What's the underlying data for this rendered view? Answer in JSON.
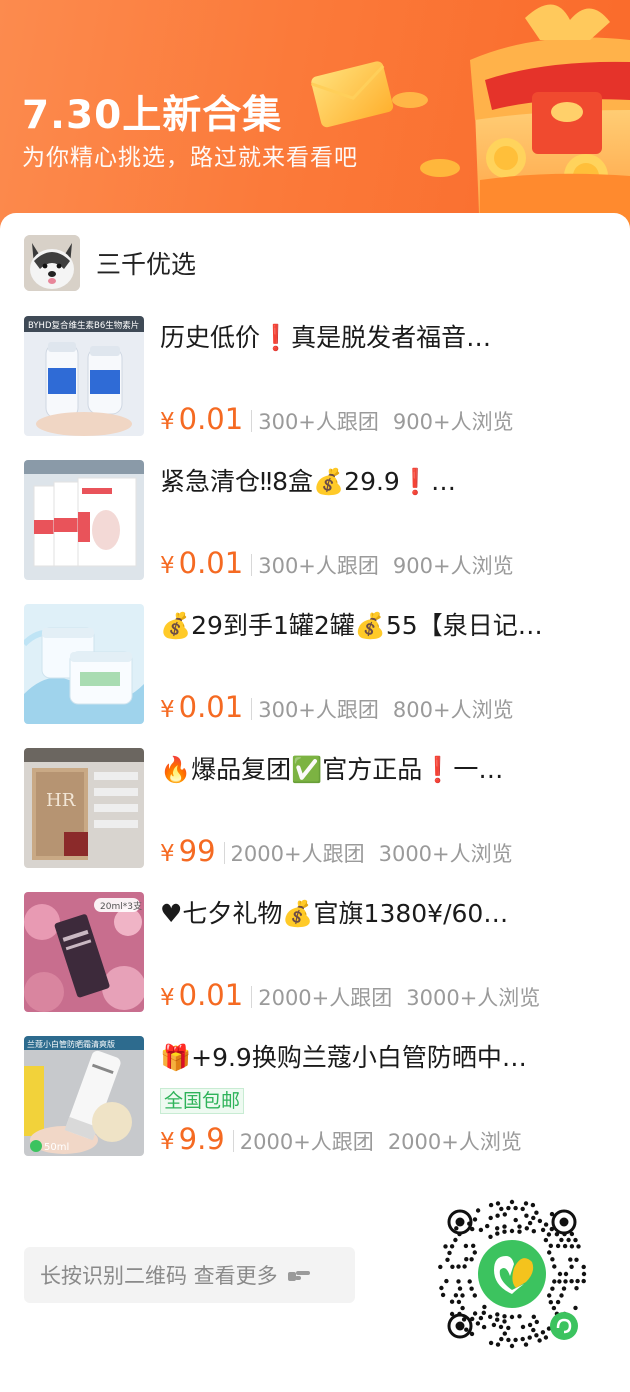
{
  "banner": {
    "title": "7.30上新合集",
    "subtitle": "为你精心挑选，路过就来看看吧"
  },
  "shop": {
    "name": "三千优选"
  },
  "products": [
    {
      "title": "历史低价❗真是脱发者福音…",
      "currency": "¥",
      "price": "0.01",
      "group_count": "300+人跟团",
      "view_count": "900+人浏览",
      "thumb_label": "BYHD复合维生素B6生物素片"
    },
    {
      "title": "紧急清仓‼8盒💰29.9❗…",
      "currency": "¥",
      "price": "0.01",
      "group_count": "300+人跟团",
      "view_count": "900+人浏览"
    },
    {
      "title": "💰29到手1罐2罐💰55【泉日记…",
      "currency": "¥",
      "price": "0.01",
      "group_count": "300+人跟团",
      "view_count": "800+人浏览"
    },
    {
      "title": "🔥爆品复团✅官方正品❗一…",
      "currency": "¥",
      "price": "99",
      "group_count": "2000+人跟团",
      "view_count": "3000+人浏览",
      "thumb_label": "HR"
    },
    {
      "title": "♥七夕礼物💰官旗1380¥/60…",
      "currency": "¥",
      "price": "0.01",
      "group_count": "2000+人跟团",
      "view_count": "3000+人浏览",
      "thumb_label": "20ml*3支"
    },
    {
      "title": "🎁+9.9换购兰蔻小白管防晒中…",
      "tag": "全国包邮",
      "currency": "¥",
      "price": "9.9",
      "group_count": "2000+人跟团",
      "view_count": "2000+人浏览",
      "thumb_label": "兰蔻小白管防晒霜清爽版",
      "thumb_badge": "50ml"
    }
  ],
  "footer": {
    "more_label": "长按识别二维码 查看更多"
  },
  "colors": {
    "brand_orange": "#fb7a3a",
    "price_orange": "#f56a22",
    "tag_green": "#2fb35a",
    "qr_green": "#3cc35f"
  }
}
